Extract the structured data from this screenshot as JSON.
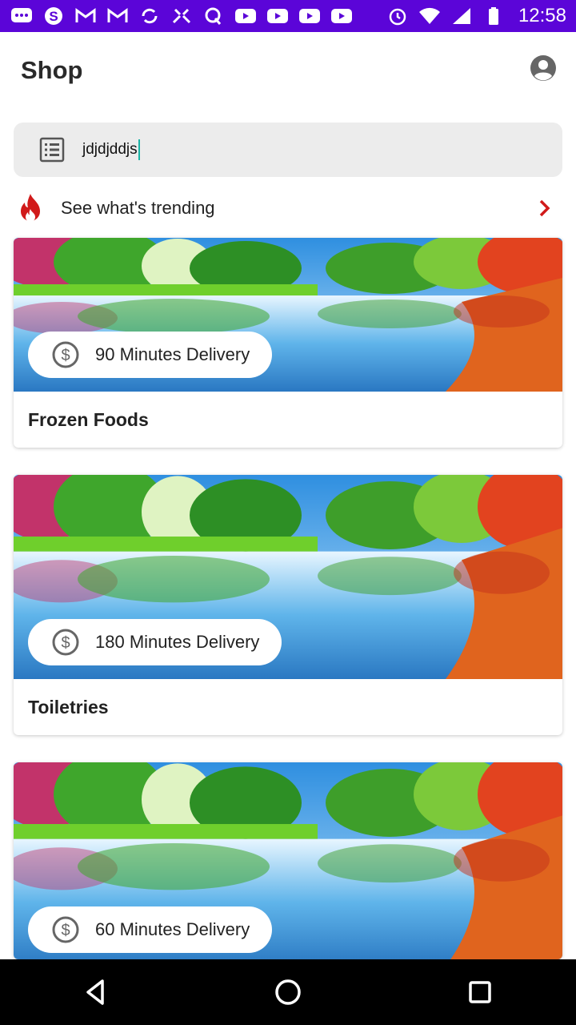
{
  "status_bar": {
    "time": "12:58",
    "left_icons": [
      "message-icon",
      "skype-icon",
      "gmail-icon",
      "gmail-icon",
      "sync-icon",
      "tools-icon",
      "quora-icon",
      "youtube-icon",
      "youtube-icon",
      "youtube-icon",
      "youtube-icon"
    ],
    "right_icons": [
      "alarm-icon",
      "wifi-icon",
      "signal-icon",
      "battery-icon"
    ],
    "background": "#5b05d8"
  },
  "app_bar": {
    "title": "Shop",
    "account_icon": "account-circle-icon"
  },
  "search": {
    "value": "jdjdjddjs",
    "icon": "list-icon"
  },
  "trending": {
    "label": "See what's trending",
    "icon": "fire-icon",
    "accent": "#d11a1a"
  },
  "cards": [
    {
      "delivery": "90 Minutes Delivery",
      "title": "Frozen Foods"
    },
    {
      "delivery": "180 Minutes Delivery",
      "title": "Toiletries"
    },
    {
      "delivery": "60 Minutes Delivery",
      "title": ""
    }
  ],
  "nav": {
    "back_icon": "back-triangle-icon",
    "home_icon": "home-circle-icon",
    "recents_icon": "recents-square-icon"
  }
}
